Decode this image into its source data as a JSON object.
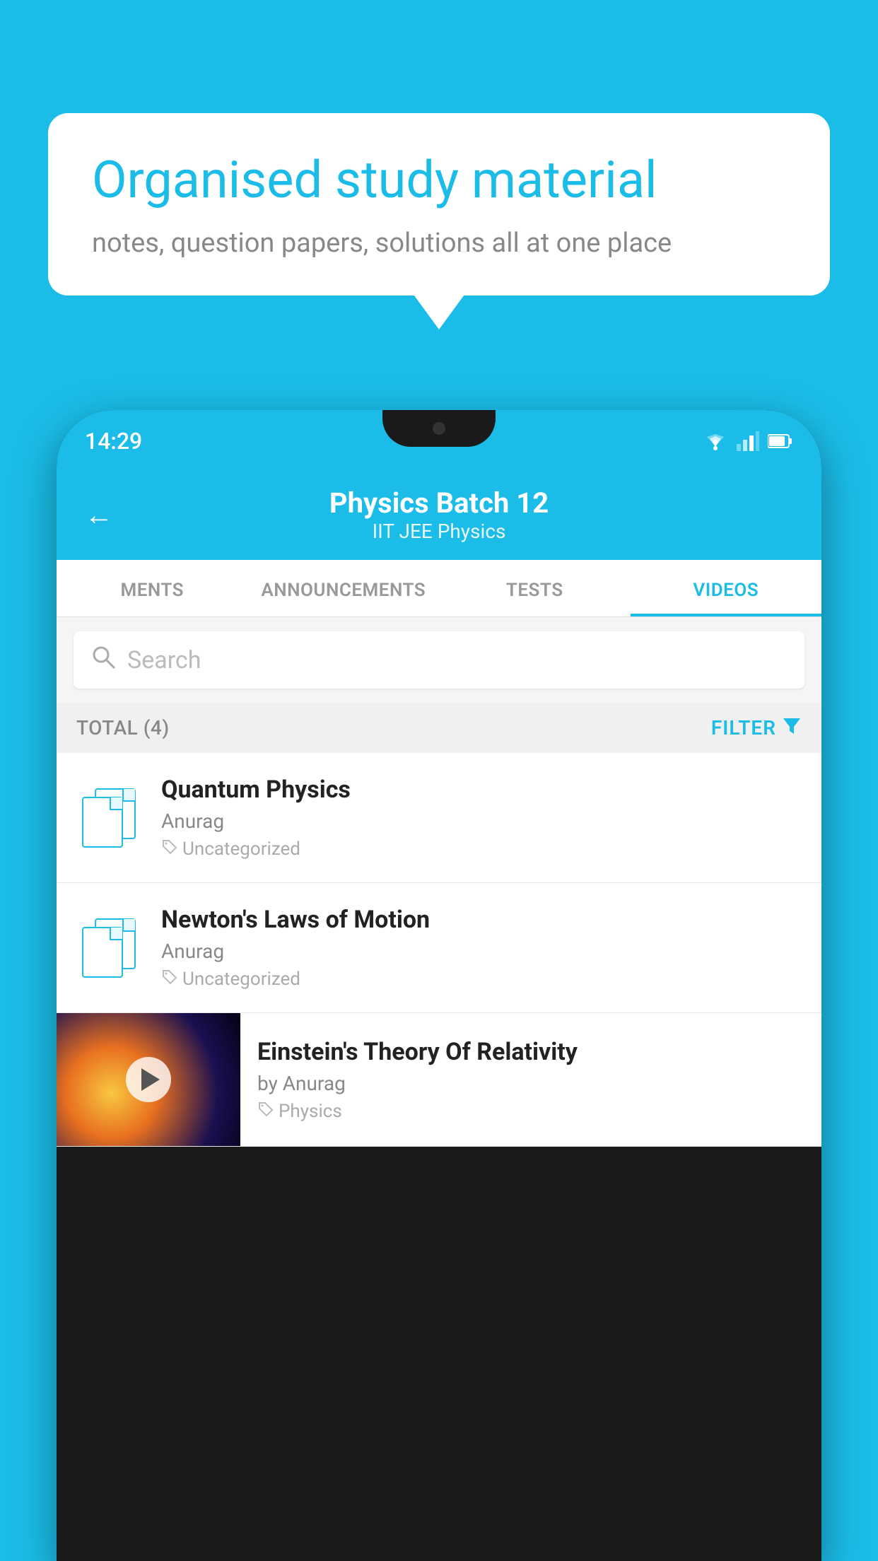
{
  "background_color": "#1BBDE8",
  "speech_bubble": {
    "heading": "Organised study material",
    "subtext": "notes, question papers, solutions all at one place"
  },
  "phone": {
    "status_bar": {
      "time": "14:29"
    },
    "header": {
      "title": "Physics Batch 12",
      "subtitle": "IIT JEE   Physics",
      "back_label": "←"
    },
    "tabs": [
      {
        "label": "MENTS",
        "active": false
      },
      {
        "label": "ANNOUNCEMENTS",
        "active": false
      },
      {
        "label": "TESTS",
        "active": false
      },
      {
        "label": "VIDEOS",
        "active": true
      }
    ],
    "search": {
      "placeholder": "Search"
    },
    "filter_bar": {
      "total_label": "TOTAL (4)",
      "filter_label": "FILTER"
    },
    "videos": [
      {
        "id": 1,
        "title": "Quantum Physics",
        "author": "Anurag",
        "tag": "Uncategorized",
        "has_thumbnail": false
      },
      {
        "id": 2,
        "title": "Newton's Laws of Motion",
        "author": "Anurag",
        "tag": "Uncategorized",
        "has_thumbnail": false
      },
      {
        "id": 3,
        "title": "Einstein's Theory Of Relativity",
        "author": "by Anurag",
        "tag": "Physics",
        "has_thumbnail": true
      }
    ]
  }
}
